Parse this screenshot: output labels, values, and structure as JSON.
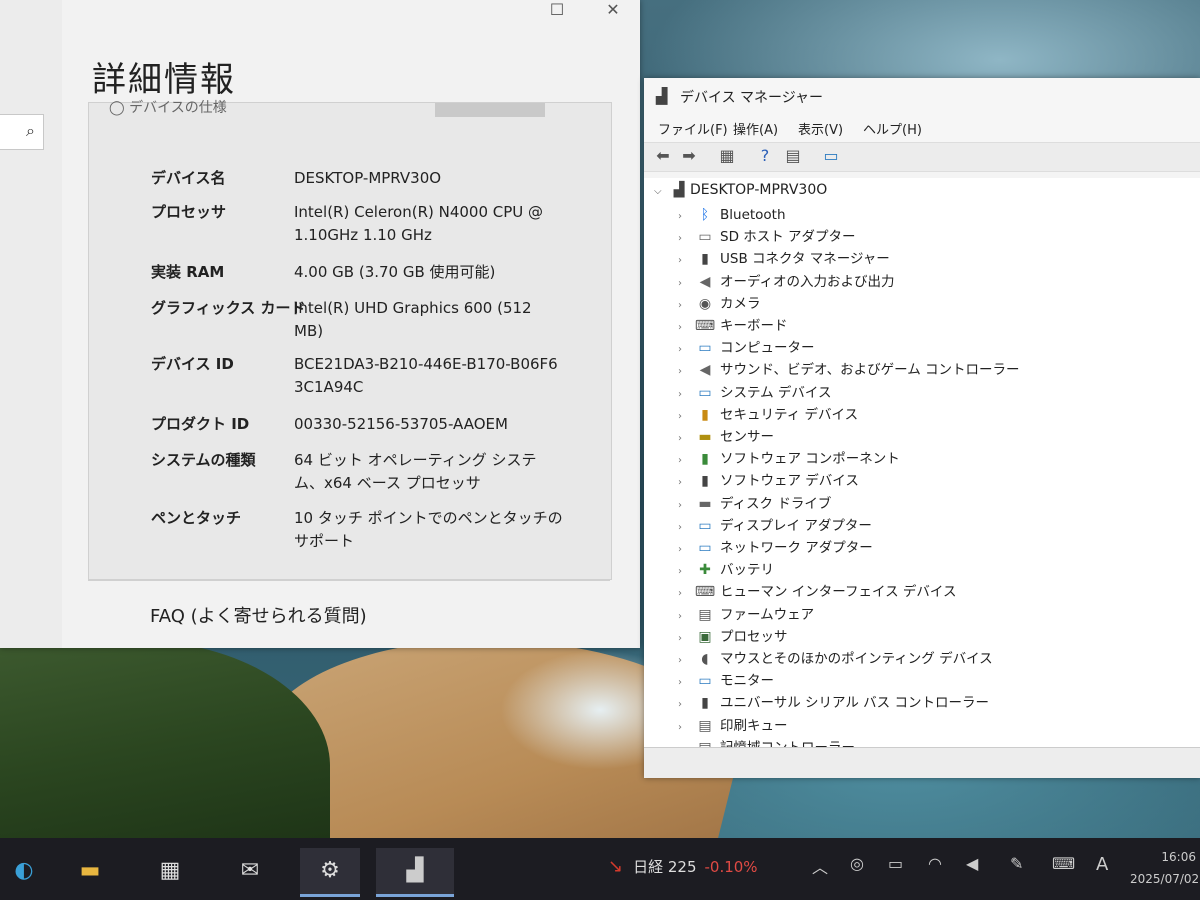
{
  "settings": {
    "page_title": "詳細情報",
    "cut_row_text": "デバイスの仕様",
    "specs": [
      {
        "label": "デバイス名",
        "value": "DESKTOP-MPRV30O"
      },
      {
        "label": "プロセッサ",
        "value": "Intel(R) Celeron(R) N4000 CPU @ 1.10GHz 1.10 GHz"
      },
      {
        "label": "実装 RAM",
        "value": "4.00 GB (3.70 GB 使用可能)"
      },
      {
        "label": "グラフィックス カード",
        "value": "Intel(R) UHD Graphics 600 (512 MB)"
      },
      {
        "label": "デバイス ID",
        "value": "BCE21DA3-B210-446E-B170-B06F63C1A94C"
      },
      {
        "label": "プロダクト ID",
        "value": "00330-52156-53705-AAOEM"
      },
      {
        "label": "システムの種類",
        "value": "64 ビット オペレーティング システム、x64 ベース プロセッサ"
      },
      {
        "label": "ペンとタッチ",
        "value": "10 タッチ ポイントでのペンとタッチのサポート"
      }
    ],
    "faq": "FAQ (よく寄せられる質問)",
    "window_controls": {
      "maximize": "☐",
      "close": "✕"
    },
    "search_icon": "⌕"
  },
  "device_manager": {
    "title": "デバイス マネージャー",
    "menu": [
      "ファイル(F)",
      "操作(A)",
      "表示(V)",
      "ヘルプ(H)"
    ],
    "root": "DESKTOP-MPRV30O",
    "categories": [
      {
        "label": "Bluetooth",
        "icon": "bluetooth-icon",
        "glyph": "ᛒ",
        "color": "#1a73e8"
      },
      {
        "label": "SD ホスト アダプター",
        "icon": "sd-host-icon",
        "glyph": "▭",
        "color": "#666"
      },
      {
        "label": "USB コネクタ マネージャー",
        "icon": "usb-connector-icon",
        "glyph": "▮",
        "color": "#444"
      },
      {
        "label": "オーディオの入力および出力",
        "icon": "audio-icon",
        "glyph": "◀",
        "color": "#666"
      },
      {
        "label": "カメラ",
        "icon": "camera-icon",
        "glyph": "◉",
        "color": "#555"
      },
      {
        "label": "キーボード",
        "icon": "keyboard-icon",
        "glyph": "⌨",
        "color": "#555"
      },
      {
        "label": "コンピューター",
        "icon": "computer-icon",
        "glyph": "▭",
        "color": "#2b7bc0"
      },
      {
        "label": "サウンド、ビデオ、およびゲーム コントローラー",
        "icon": "sound-icon",
        "glyph": "◀",
        "color": "#666"
      },
      {
        "label": "システム デバイス",
        "icon": "system-device-icon",
        "glyph": "▭",
        "color": "#2b7bc0"
      },
      {
        "label": "セキュリティ デバイス",
        "icon": "security-device-icon",
        "glyph": "▮",
        "color": "#c98a12"
      },
      {
        "label": "センサー",
        "icon": "sensor-icon",
        "glyph": "▬",
        "color": "#b09010"
      },
      {
        "label": "ソフトウェア コンポーネント",
        "icon": "software-component-icon",
        "glyph": "▮",
        "color": "#3a8a3a"
      },
      {
        "label": "ソフトウェア デバイス",
        "icon": "software-device-icon",
        "glyph": "▮",
        "color": "#444"
      },
      {
        "label": "ディスク ドライブ",
        "icon": "disk-drive-icon",
        "glyph": "▬",
        "color": "#666"
      },
      {
        "label": "ディスプレイ アダプター",
        "icon": "display-adapter-icon",
        "glyph": "▭",
        "color": "#2b7bc0"
      },
      {
        "label": "ネットワーク アダプター",
        "icon": "network-adapter-icon",
        "glyph": "▭",
        "color": "#2b7bc0"
      },
      {
        "label": "バッテリ",
        "icon": "battery-icon",
        "glyph": "✚",
        "color": "#3a8a3a"
      },
      {
        "label": "ヒューマン インターフェイス デバイス",
        "icon": "hid-icon",
        "glyph": "⌨",
        "color": "#555"
      },
      {
        "label": "ファームウェア",
        "icon": "firmware-icon",
        "glyph": "▤",
        "color": "#555"
      },
      {
        "label": "プロセッサ",
        "icon": "processor-icon",
        "glyph": "▣",
        "color": "#3a6a3a"
      },
      {
        "label": "マウスとそのほかのポインティング デバイス",
        "icon": "mouse-icon",
        "glyph": "◖",
        "color": "#555"
      },
      {
        "label": "モニター",
        "icon": "monitor-icon",
        "glyph": "▭",
        "color": "#2b7bc0"
      },
      {
        "label": "ユニバーサル シリアル バス コントローラー",
        "icon": "usb-controller-icon",
        "glyph": "▮",
        "color": "#444"
      },
      {
        "label": "印刷キュー",
        "icon": "print-queue-icon",
        "glyph": "▤",
        "color": "#555"
      },
      {
        "label": "記憶域コントローラー",
        "icon": "storage-controller-icon",
        "glyph": "▤",
        "color": "#555"
      }
    ]
  },
  "taskbar": {
    "news_label": "日経 225",
    "news_change": "-0.10%",
    "news_change_color": "#e04a44",
    "ime": "A",
    "time": "16:06",
    "date": "2025/07/02"
  }
}
